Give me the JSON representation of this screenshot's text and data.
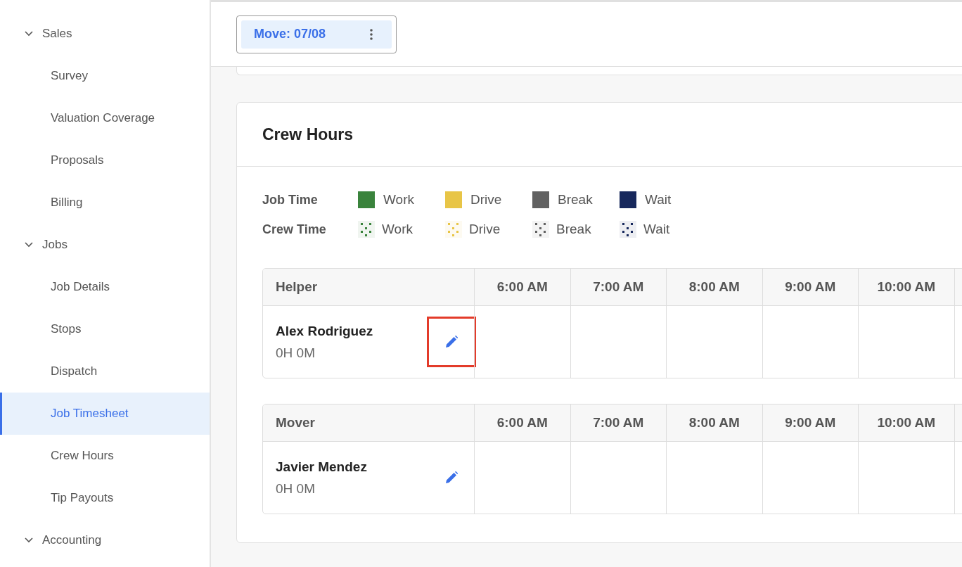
{
  "sidebar": {
    "groups": [
      {
        "label": "Sales",
        "expanded": true,
        "items": [
          {
            "label": "Survey",
            "selected": false
          },
          {
            "label": "Valuation Coverage",
            "selected": false
          },
          {
            "label": "Proposals",
            "selected": false
          },
          {
            "label": "Billing",
            "selected": false
          }
        ]
      },
      {
        "label": "Jobs",
        "expanded": true,
        "items": [
          {
            "label": "Job Details",
            "selected": false
          },
          {
            "label": "Stops",
            "selected": false
          },
          {
            "label": "Dispatch",
            "selected": false
          },
          {
            "label": "Job Timesheet",
            "selected": true
          },
          {
            "label": "Crew Hours",
            "selected": false
          },
          {
            "label": "Tip Payouts",
            "selected": false
          }
        ]
      },
      {
        "label": "Accounting",
        "expanded": true
      }
    ]
  },
  "move_chip": {
    "label": "Move: 07/08"
  },
  "crew_hours": {
    "title": "Crew Hours",
    "legend": [
      {
        "label": "Job Time",
        "kind": "solid",
        "entries": [
          {
            "label": "Work",
            "color": "#3a833c"
          },
          {
            "label": "Drive",
            "color": "#e8c547"
          },
          {
            "label": "Break",
            "color": "#616161"
          },
          {
            "label": "Wait",
            "color": "#17285c"
          }
        ]
      },
      {
        "label": "Crew Time",
        "kind": "dotted",
        "entries": [
          {
            "label": "Work",
            "color": "#3a833c"
          },
          {
            "label": "Drive",
            "color": "#e8c547"
          },
          {
            "label": "Break",
            "color": "#616161"
          },
          {
            "label": "Wait",
            "color": "#17285c"
          }
        ]
      }
    ],
    "tables": [
      {
        "role": "Helper",
        "columns": [
          "6:00 AM",
          "7:00 AM",
          "8:00 AM",
          "9:00 AM",
          "10:00 AM"
        ],
        "members": [
          {
            "name": "Alex Rodriguez",
            "total": "0H 0M",
            "highlighted": true
          }
        ]
      },
      {
        "role": "Mover",
        "columns": [
          "6:00 AM",
          "7:00 AM",
          "8:00 AM",
          "9:00 AM",
          "10:00 AM"
        ],
        "members": [
          {
            "name": "Javier Mendez",
            "total": "0H 0M",
            "highlighted": false
          }
        ]
      }
    ]
  }
}
